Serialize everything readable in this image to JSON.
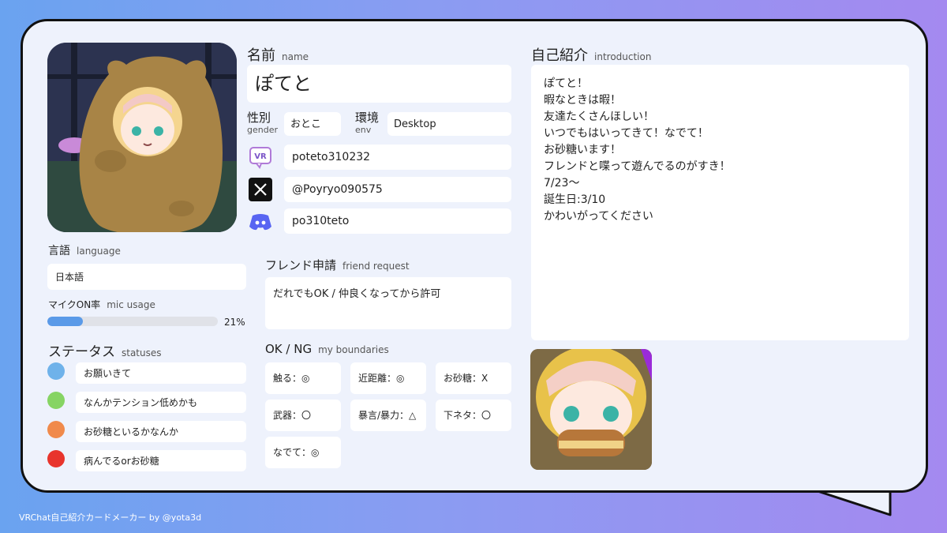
{
  "title": {
    "main": "名前",
    "sub": "name"
  },
  "name_value": "ぽてと",
  "gender": {
    "main": "性別",
    "sub": "gender",
    "value": "おとこ"
  },
  "env": {
    "main": "環境",
    "sub": "env",
    "value": "Desktop"
  },
  "socials": {
    "vrchat": "poteto310232",
    "x": "@Poyryo090575",
    "discord": "po310teto"
  },
  "friend_request": {
    "main": "フレンド申請",
    "sub": "friend request",
    "value": "だれでもOK / 仲良くなってから許可"
  },
  "boundaries": {
    "main": "OK / NG",
    "sub": "my boundaries",
    "items": [
      "触る：◎",
      "近距離：◎",
      "お砂糖：X",
      "武器：〇",
      "暴言/暴力：△",
      "下ネタ：〇",
      "なでて：◎"
    ]
  },
  "language": {
    "main": "言語",
    "sub": "language",
    "value": "日本語"
  },
  "mic": {
    "main": "マイクON率",
    "sub": "mic usage",
    "percent_text": "21%",
    "percent": 21
  },
  "statuses": {
    "main": "ステータス",
    "sub": "statuses",
    "items": [
      {
        "label": "お願いきて",
        "color": "#6fb2ea"
      },
      {
        "label": "なんかテンション低めかも",
        "color": "#86d463"
      },
      {
        "label": "お砂糖といるかなんか",
        "color": "#f08a4b"
      },
      {
        "label": "病んでるorお砂糖",
        "color": "#e8342c"
      }
    ]
  },
  "intro": {
    "main": "自己紹介",
    "sub": "introduction",
    "lines": [
      "ぽてと！",
      "暇なときは暇！",
      "友達たくさんほしい！",
      "いつでもはいってきて！なでて！",
      "お砂糖います！",
      "フレンドと喋って遊んでるのがすき！",
      "7/23〜",
      "誕生日:3/10",
      "かわいがってください"
    ]
  },
  "icons": {
    "vrchat": "vrchat-icon",
    "x": "x-logo-icon",
    "discord": "discord-icon"
  },
  "footer": "VRChat自己紹介カードメーカー by @yota3d"
}
